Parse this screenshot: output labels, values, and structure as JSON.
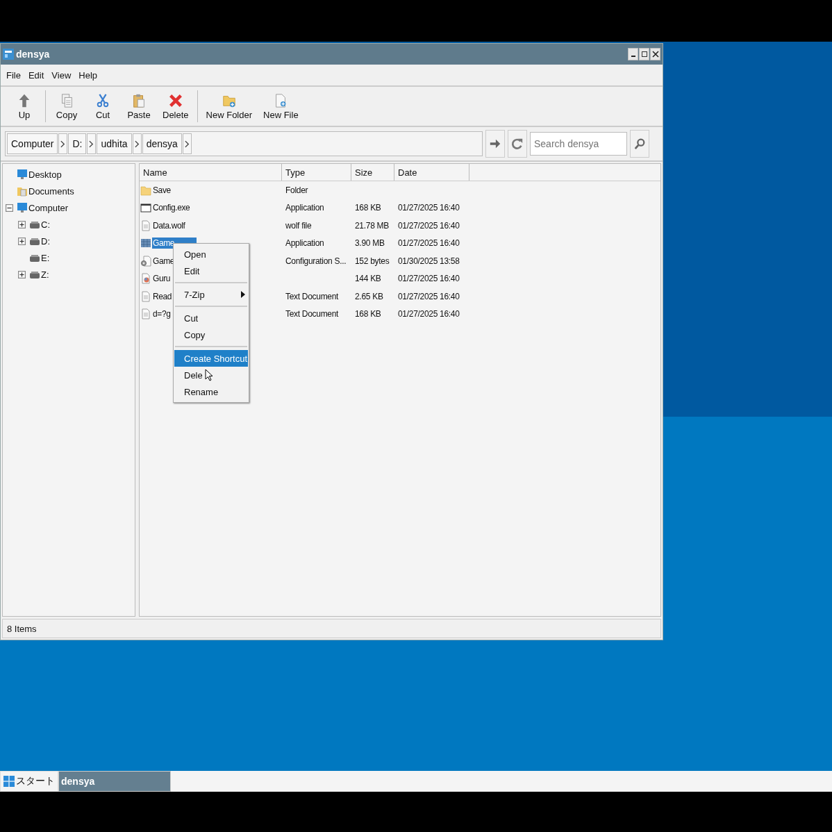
{
  "window": {
    "title": "densya"
  },
  "menu": [
    "File",
    "Edit",
    "View",
    "Help"
  ],
  "toolbar": [
    {
      "label": "Up",
      "kind": "up",
      "separator_after": true
    },
    {
      "label": "Copy",
      "kind": "copy",
      "separator_after": false
    },
    {
      "label": "Cut",
      "kind": "cut",
      "separator_after": false
    },
    {
      "label": "Paste",
      "kind": "paste",
      "separator_after": false
    },
    {
      "label": "Delete",
      "kind": "delete",
      "separator_after": true
    },
    {
      "label": "New Folder",
      "kind": "new-folder",
      "separator_after": false
    },
    {
      "label": "New File",
      "kind": "new-file",
      "separator_after": false
    }
  ],
  "breadcrumbs": [
    "Computer",
    "D:",
    "udhita",
    "densya"
  ],
  "search": {
    "placeholder": "Search densya"
  },
  "tree": [
    {
      "label": "Desktop",
      "kind": "desktop"
    },
    {
      "label": "Documents",
      "kind": "documents"
    },
    {
      "label": "Computer",
      "kind": "computer",
      "expandable": true,
      "expanded": true,
      "children": [
        {
          "label": "C:",
          "expandable": true,
          "expanded": false
        },
        {
          "label": "D:",
          "expandable": true,
          "expanded": false
        },
        {
          "label": "E:"
        },
        {
          "label": "Z:",
          "expandable": true,
          "expanded": false
        }
      ]
    }
  ],
  "table": {
    "columns": [
      "Name",
      "Type",
      "Size",
      "Date"
    ],
    "rows": [
      {
        "name": "Save",
        "kind": "folder",
        "type": "Folder",
        "size": "",
        "date": "",
        "selected": false
      },
      {
        "name": "Config.exe",
        "kind": "window",
        "type": "Application",
        "size": "168 KB",
        "date": "01/27/2025 16:40",
        "selected": false
      },
      {
        "name": "Data.wolf",
        "kind": "document",
        "type": "wolf file",
        "size": "21.78 MB",
        "date": "01/27/2025 16:40",
        "selected": false
      },
      {
        "name": "Game",
        "kind": "grid",
        "type": "Application",
        "size": "3.90 MB",
        "date": "01/27/2025 16:40",
        "selected": true
      },
      {
        "name": "Game",
        "kind": "settings",
        "type": "Configuration S...",
        "size": "152 bytes",
        "date": "01/30/2025 13:58",
        "selected": false
      },
      {
        "name": "Guru",
        "kind": "app",
        "type": "",
        "size": "144 KB",
        "date": "01/27/2025 16:40",
        "selected": false
      },
      {
        "name": "Read",
        "kind": "document",
        "type": "Text Document",
        "size": "2.65 KB",
        "date": "01/27/2025 16:40",
        "selected": false
      },
      {
        "name": "d=?g",
        "kind": "document",
        "type": "Text Document",
        "size": "168 KB",
        "date": "01/27/2025 16:40",
        "selected": false
      }
    ]
  },
  "context_menu": [
    {
      "label": "Open",
      "kind": "item",
      "selected": false
    },
    {
      "label": "Edit",
      "kind": "item",
      "selected": false
    },
    {
      "kind": "separator"
    },
    {
      "label": "7-Zip",
      "kind": "submenu",
      "selected": false
    },
    {
      "kind": "separator"
    },
    {
      "label": "Cut",
      "kind": "item",
      "selected": false
    },
    {
      "label": "Copy",
      "kind": "item",
      "selected": false
    },
    {
      "kind": "separator"
    },
    {
      "label": "Create Shortcut",
      "kind": "item",
      "selected": true
    },
    {
      "label": "Dele",
      "kind": "item",
      "selected": false
    },
    {
      "label": "Rename",
      "kind": "item",
      "selected": false
    }
  ],
  "status_bar": "8 Items",
  "taskbar": {
    "start": "スタート",
    "tasks": [
      {
        "label": "densya",
        "selected": true
      }
    ]
  }
}
